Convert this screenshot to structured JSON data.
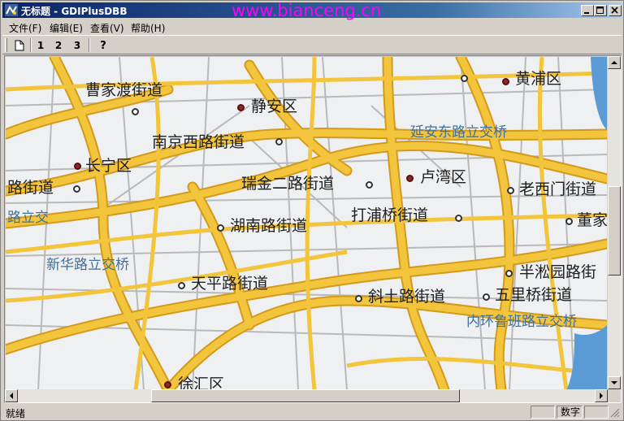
{
  "window": {
    "title": "无标题 - GDIPlusDBB",
    "watermark": "www.bianceng.cn"
  },
  "menu": [
    {
      "label": "文件(F)"
    },
    {
      "label": "编辑(E)"
    },
    {
      "label": "查看(V)"
    },
    {
      "label": "帮助(H)"
    }
  ],
  "toolbar": {
    "buttons": [
      {
        "name": "new-icon",
        "label": ""
      },
      {
        "label": "1"
      },
      {
        "label": "2"
      },
      {
        "label": "3"
      },
      {
        "name": "help-icon",
        "label": "?"
      }
    ]
  },
  "map": {
    "places": [
      {
        "label": "曹家渡街道",
        "style": "dark"
      },
      {
        "label": "静安区",
        "style": "dark"
      },
      {
        "label": "南京西路街道",
        "style": "dark"
      },
      {
        "label": "延安东路立交桥",
        "style": "blue"
      },
      {
        "label": "长宁区",
        "style": "dark"
      },
      {
        "label": "路街道",
        "style": "dark"
      },
      {
        "label": "瑞金二路街道",
        "style": "dark"
      },
      {
        "label": "卢湾区",
        "style": "dark"
      },
      {
        "label": "老西门街道",
        "style": "dark"
      },
      {
        "label": "路立交",
        "style": "blue"
      },
      {
        "label": "湖南路街道",
        "style": "dark"
      },
      {
        "label": "打浦桥街道",
        "style": "dark"
      },
      {
        "label": "董家",
        "style": "dark"
      },
      {
        "label": "新华路立交桥",
        "style": "blue"
      },
      {
        "label": "半淞园路街",
        "style": "dark"
      },
      {
        "label": "天平路街道",
        "style": "dark"
      },
      {
        "label": "斜土路街道",
        "style": "dark"
      },
      {
        "label": "五里桥街道",
        "style": "dark"
      },
      {
        "label": "内环鲁班路立交桥",
        "style": "blue"
      },
      {
        "label": "徐汇区",
        "style": "dark"
      },
      {
        "label": "黄浦区",
        "style": "dark"
      }
    ]
  },
  "status": {
    "text": "就绪",
    "panes": [
      "",
      "数字",
      ""
    ]
  },
  "colors": {
    "titlebar_start": "#0a246a",
    "road": "#f0c23a",
    "water": "#5a9bd6"
  }
}
